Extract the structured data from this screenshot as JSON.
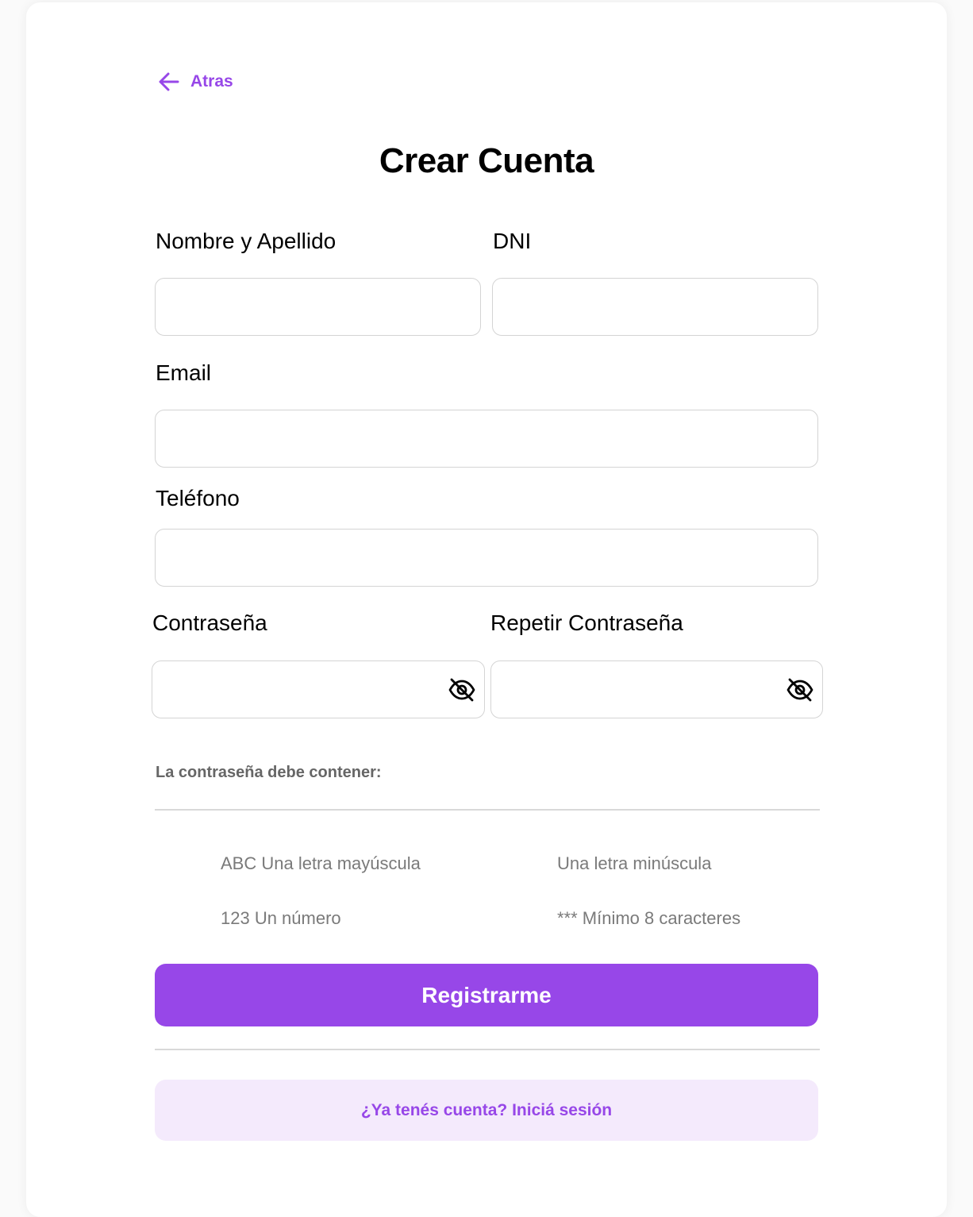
{
  "colors": {
    "accent": "#9747e8",
    "accent_light": "#f4eafc",
    "border": "#d4d4d4",
    "muted_text": "#7a7a7a"
  },
  "back": {
    "icon": "arrow-left-icon",
    "label": "Atras"
  },
  "title": "Crear Cuenta",
  "fields": {
    "name": {
      "label": "Nombre y Apellido",
      "value": "",
      "placeholder": ""
    },
    "dni": {
      "label": "DNI",
      "value": "",
      "placeholder": ""
    },
    "email": {
      "label": "Email",
      "value": "",
      "placeholder": ""
    },
    "phone": {
      "label": "Teléfono",
      "value": "",
      "placeholder": ""
    },
    "password": {
      "label": "Contraseña",
      "value": "",
      "placeholder": "",
      "icon": "eye-off-icon"
    },
    "password_repeat": {
      "label": "Repetir Contraseña",
      "value": "",
      "placeholder": "",
      "icon": "eye-off-icon"
    }
  },
  "password_rules": {
    "title": "La contraseña debe contener:",
    "items": [
      "ABC Una letra mayúscula",
      "Una letra minúscula",
      "123 Un número",
      "*** Mínimo 8 caracteres"
    ]
  },
  "submit_label": "Registrarme",
  "login_prompt": "¿Ya tenés cuenta? Iniciá sesión"
}
